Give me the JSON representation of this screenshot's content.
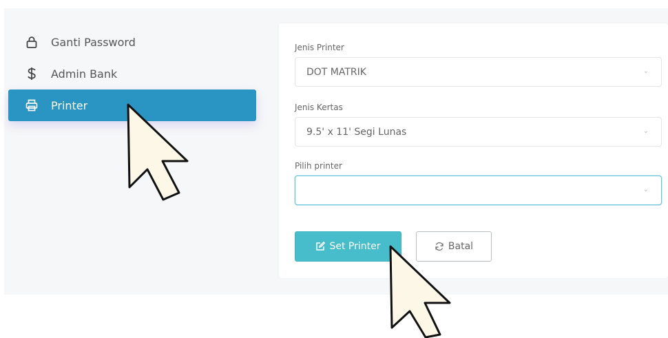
{
  "sidebar": {
    "items": [
      {
        "label": "Ganti Password",
        "icon": "lock-icon",
        "active": false
      },
      {
        "label": "Admin Bank",
        "icon": "dollar-icon",
        "active": false
      },
      {
        "label": "Printer",
        "icon": "printer-icon",
        "active": true
      }
    ]
  },
  "form": {
    "printer_type": {
      "label": "Jenis Printer",
      "value": "DOT MATRIK"
    },
    "paper_type": {
      "label": "Jenis Kertas",
      "value": "9.5' x 11' Segi Lunas"
    },
    "choose_printer": {
      "label": "Pilih printer",
      "value": ""
    },
    "set_button": {
      "label": "Set Printer",
      "icon": "edit-icon"
    },
    "cancel_button": {
      "label": "Batal",
      "icon": "refresh-icon"
    }
  },
  "colors": {
    "active_item": "#2a95c3",
    "primary_button": "#47bccb",
    "focus_border": "#66c4d6"
  }
}
